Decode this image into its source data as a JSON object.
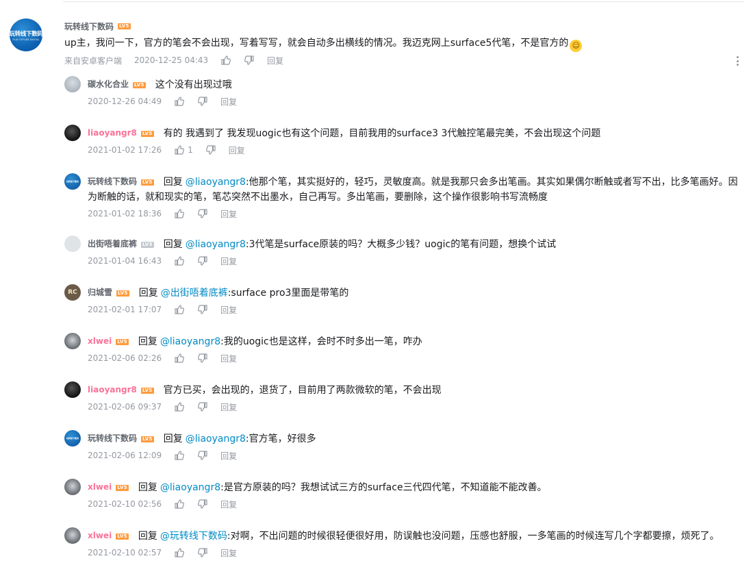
{
  "main_comment": {
    "avatar_text": "玩转线下数码",
    "avatar_subtext": "PLAY OFFLINE DIGITAL",
    "user": "玩转线下数码",
    "level": "LV5",
    "text": "up主，我问一下，官方的笔会不会出现，写着写写，就会自动多出横线的情况。我迈克网上surface5代笔，不是官方的",
    "emoji": "😂",
    "source": "来自安卓客户端",
    "time": "2020-12-25 04:43",
    "reply_label": "回复"
  },
  "replies": [
    {
      "user": "碳水化合业",
      "level": "LV5",
      "prefix": "",
      "at": "",
      "text": "这个没有出现过哦",
      "time": "2020-12-26 04:49",
      "likes": "",
      "reply_label": "回复"
    },
    {
      "user": "liaoyangr8",
      "level": "LV5",
      "prefix": "",
      "at": "",
      "text": "有的 我遇到了 我发现uogic也有这个问题，目前我用的surface3 3代触控笔最完美，不会出现这个问题",
      "time": "2021-01-02 17:26",
      "likes": "1",
      "reply_label": "回复"
    },
    {
      "user": "玩转线下数码",
      "level": "LV5",
      "prefix": "回复",
      "at": "@liaoyangr8",
      "text": ":他那个笔，其实挺好的，轻巧，灵敏度高。就是我那只会多出笔画。其实如果偶尔断触或者写不出，比多笔画好。因为断触的话，就和现实的笔，笔芯突然不出墨水，自己再写。多出笔画，要删除，这个操作很影响书写流畅度",
      "time": "2021-01-02 18:36",
      "likes": "",
      "reply_label": "回复"
    },
    {
      "user": "出街唔着底裤",
      "level": "LV3",
      "prefix": "回复",
      "at": "@liaoyangr8",
      "text": ":3代笔是surface原装的吗？大概多少钱？uogic的笔有问题，想换个试试",
      "time": "2021-01-04 16:43",
      "likes": "",
      "reply_label": "回复"
    },
    {
      "user": "归城雪",
      "level": "LV5",
      "prefix": "回复",
      "at": "@出街唔着底裤",
      "text": ":surface pro3里面是带笔的",
      "time": "2021-02-01 17:07",
      "likes": "",
      "reply_label": "回复"
    },
    {
      "user": "xlwei",
      "level": "LV5",
      "prefix": "回复",
      "at": "@liaoyangr8",
      "text": ":我的uogic也是这样，会时不时多出一笔，咋办",
      "time": "2021-02-06 02:26",
      "likes": "",
      "reply_label": "回复"
    },
    {
      "user": "liaoyangr8",
      "level": "LV5",
      "prefix": "",
      "at": "",
      "text": "官方已买，会出现的，退货了，目前用了两款微软的笔，不会出现",
      "time": "2021-02-06 09:37",
      "likes": "",
      "reply_label": "回复"
    },
    {
      "user": "玩转线下数码",
      "level": "LV5",
      "prefix": "回复",
      "at": "@liaoyangr8",
      "text": ":官方笔，好很多",
      "time": "2021-02-06 12:09",
      "likes": "",
      "reply_label": "回复"
    },
    {
      "user": "xlwei",
      "level": "LV5",
      "prefix": "回复",
      "at": "@liaoyangr8",
      "text": ":是官方原装的吗？我想试试三方的surface三代四代笔，不知道能不能改善。",
      "time": "2021-02-10 02:56",
      "likes": "",
      "reply_label": "回复"
    },
    {
      "user": "xlwei",
      "level": "LV5",
      "prefix": "回复",
      "at": "@玩转线下数码",
      "text": ":对啊，不出问题的时候很轻便很好用，防误触也没问题，压感也舒服，一多笔画的时候连写几个字都要擦，烦死了。",
      "time": "2021-02-10 02:57",
      "likes": "",
      "reply_label": "回复"
    }
  ],
  "colors": {
    "accent_link": "#008ac5",
    "vip_name": "#fb7299",
    "level_badge": "#ff9b3d",
    "meta_text": "#9499a0"
  }
}
